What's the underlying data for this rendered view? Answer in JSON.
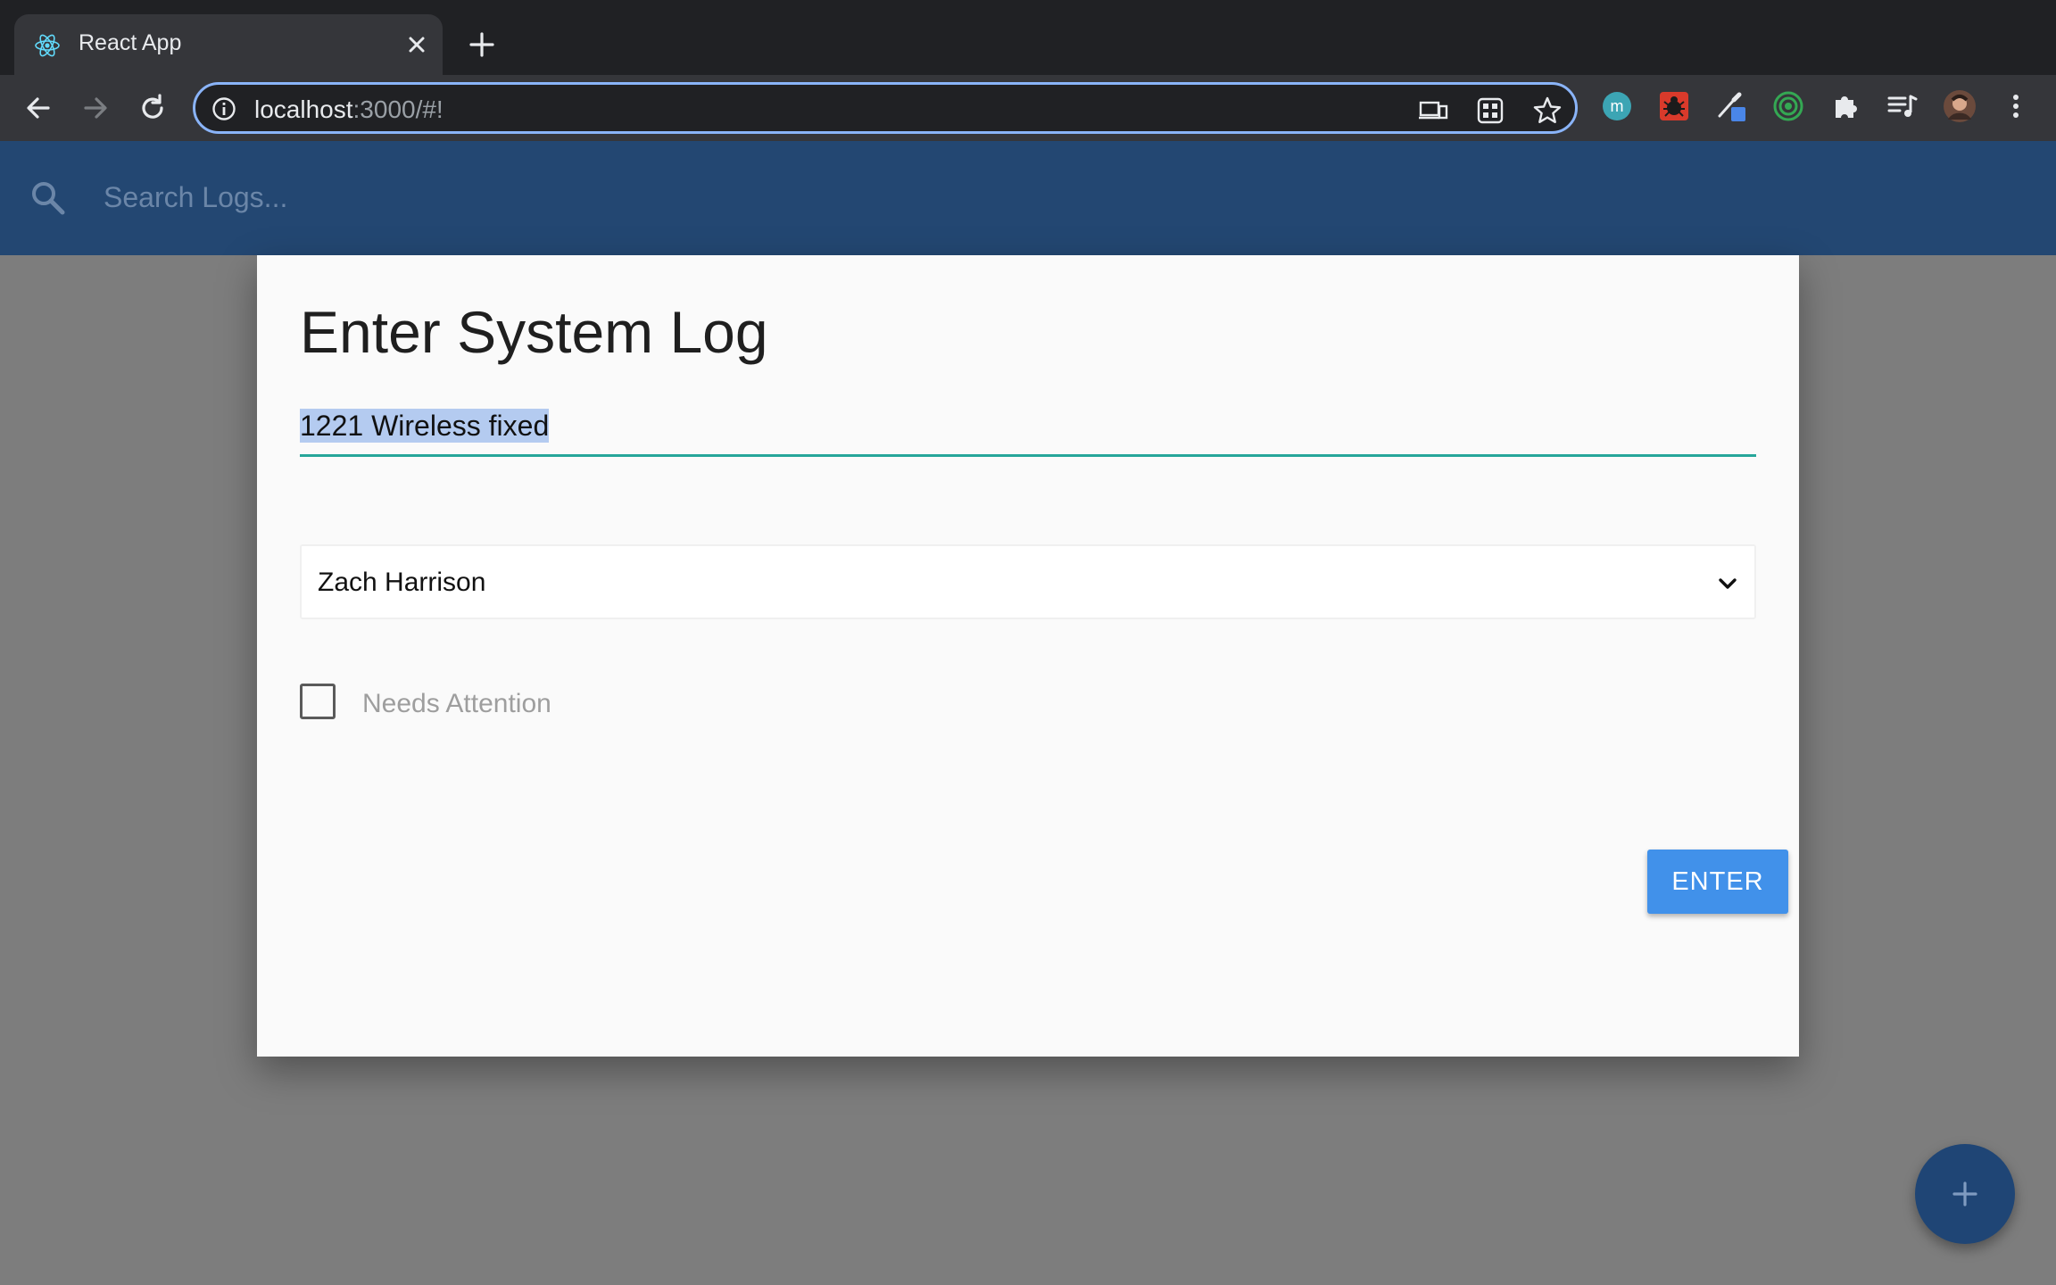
{
  "browser": {
    "tab_title": "React App",
    "url_host": "localhost",
    "url_path": ":3000/#!",
    "extensions": [
      "m-extension-icon",
      "bug-extension-icon",
      "eyedropper-extension-icon",
      "target-extension-icon",
      "puzzle-icon",
      "reading-list-icon",
      "profile-avatar"
    ]
  },
  "header": {
    "search_placeholder": "Search Logs..."
  },
  "modal": {
    "title": "Enter System Log",
    "log_value": "1221 Wireless fixed",
    "user_selected": "Zach Harrison",
    "checkbox_label": "Needs Attention",
    "checkbox_checked": false,
    "submit_label": "ENTER"
  },
  "colors": {
    "header_bg": "#234772",
    "input_underline": "#26a69a",
    "button_bg": "#4191ea",
    "fab_bg": "#1f4575"
  }
}
